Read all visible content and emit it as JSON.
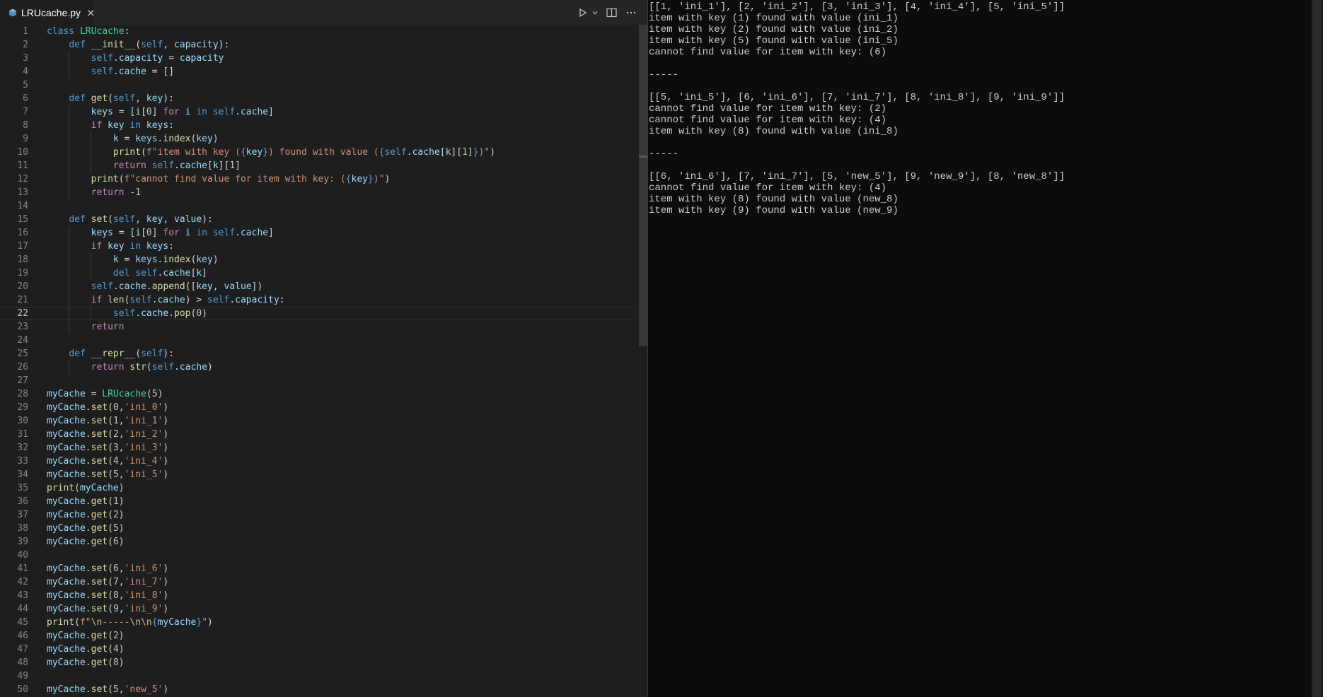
{
  "editor": {
    "tab": {
      "filename": "LRUcache.py",
      "file_icon": "python-file-icon",
      "close_icon": "close-icon"
    },
    "toolbar": {
      "run_icon": "play-icon",
      "run_menu_icon": "chevron-down-icon",
      "split_icon": "split-editor-icon",
      "more_icon": "ellipsis-icon"
    },
    "current_line": 22,
    "lines": [
      "class LRUcache:",
      "    def __init__(self, capacity):",
      "        self.capacity = capacity",
      "        self.cache = []",
      "",
      "    def get(self, key):",
      "        keys = [i[0] for i in self.cache]",
      "        if key in keys:",
      "            k = keys.index(key)",
      "            print(f\"item with key ({key}) found with value ({self.cache[k][1]})\")",
      "            return self.cache[k][1]",
      "        print(f\"cannot find value for item with key: ({key})\")",
      "        return -1",
      "",
      "    def set(self, key, value):",
      "        keys = [i[0] for i in self.cache]",
      "        if key in keys:",
      "            k = keys.index(key)",
      "            del self.cache[k]",
      "        self.cache.append([key, value])",
      "        if len(self.cache) > self.capacity:",
      "            self.cache.pop(0)",
      "        return",
      "",
      "    def __repr__(self):",
      "        return str(self.cache)",
      "",
      "myCache = LRUcache(5)",
      "myCache.set(0,'ini_0')",
      "myCache.set(1,'ini_1')",
      "myCache.set(2,'ini_2')",
      "myCache.set(3,'ini_3')",
      "myCache.set(4,'ini_4')",
      "myCache.set(5,'ini_5')",
      "print(myCache)",
      "myCache.get(1)",
      "myCache.get(2)",
      "myCache.get(5)",
      "myCache.get(6)",
      "",
      "myCache.set(6,'ini_6')",
      "myCache.set(7,'ini_7')",
      "myCache.set(8,'ini_8')",
      "myCache.set(9,'ini_9')",
      "print(f\"\\n-----\\n\\n{myCache}\")",
      "myCache.get(2)",
      "myCache.get(4)",
      "myCache.get(8)",
      "",
      "myCache.set(5,'new_5')"
    ]
  },
  "terminal": {
    "lines": [
      "[[1, 'ini_1'], [2, 'ini_2'], [3, 'ini_3'], [4, 'ini_4'], [5, 'ini_5']]",
      "item with key (1) found with value (ini_1)",
      "item with key (2) found with value (ini_2)",
      "item with key (5) found with value (ini_5)",
      "cannot find value for item with key: (6)",
      "",
      "-----",
      "",
      "[[5, 'ini_5'], [6, 'ini_6'], [7, 'ini_7'], [8, 'ini_8'], [9, 'ini_9']]",
      "cannot find value for item with key: (2)",
      "cannot find value for item with key: (4)",
      "item with key (8) found with value (ini_8)",
      "",
      "-----",
      "",
      "[[6, 'ini_6'], [7, 'ini_7'], [5, 'new_5'], [9, 'new_9'], [8, 'new_8']]",
      "cannot find value for item with key: (4)",
      "item with key (8) found with value (new_8)",
      "item with key (9) found with value (new_9)"
    ]
  },
  "colors": {
    "editor_bg": "#1e1e1e",
    "terminal_bg": "#0c0c0c",
    "keyword": "#569cd6",
    "control": "#c586c0",
    "function": "#dcdcaa",
    "class": "#4ec9b0",
    "variable": "#9cdcfe",
    "string": "#ce9178",
    "number": "#b5cea8"
  }
}
